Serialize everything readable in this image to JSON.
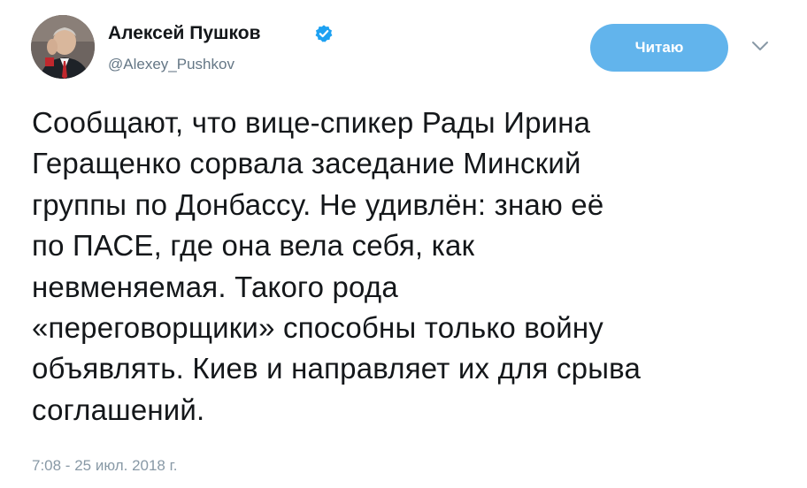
{
  "author": {
    "display_name": "Алексей Пушков",
    "handle": "@Alexey_Pushkov",
    "verified": true,
    "avatar_icon": "user-avatar"
  },
  "actions": {
    "follow_label": "Читаю",
    "follow_color": "#62b4ec",
    "more_icon": "chevron-down-icon"
  },
  "tweet": {
    "text": "Сообщают, что вице-спикер Рады Ирина\nГеращенко сорвала заседание Минский\nгруппы по Донбассу. Не удивлён: знаю её\nпо ПАСЕ, где она вела себя, как\nневменяемая. Такого рода\n«переговорщики» способны только войну\nобъявлять. Киев и направляет их для срыва\nсоглашений.",
    "timestamp": "7:08 - 25 июл. 2018 г."
  },
  "colors": {
    "text": "#14171a",
    "secondary": "#657786",
    "verified_badge": "#1da1f2"
  }
}
